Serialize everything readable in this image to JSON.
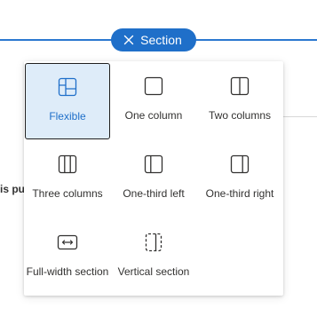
{
  "section_button": {
    "label": "Section",
    "icon": "close-icon"
  },
  "background": {
    "truncated_text": "is pu"
  },
  "layout_menu": {
    "selected": "Flexible",
    "options": [
      {
        "label": "Flexible",
        "icon": "flexible-layout-icon"
      },
      {
        "label": "One column",
        "icon": "one-column-icon"
      },
      {
        "label": "Two columns",
        "icon": "two-columns-icon"
      },
      {
        "label": "Three columns",
        "icon": "three-columns-icon"
      },
      {
        "label": "One-third left",
        "icon": "one-third-left-icon"
      },
      {
        "label": "One-third right",
        "icon": "one-third-right-icon"
      },
      {
        "label": "Full-width section",
        "icon": "full-width-icon"
      },
      {
        "label": "Vertical section",
        "icon": "vertical-section-icon"
      }
    ]
  },
  "colors": {
    "accent": "#1f6fc9",
    "selected_bg": "#deecf9",
    "text": "#323130"
  }
}
